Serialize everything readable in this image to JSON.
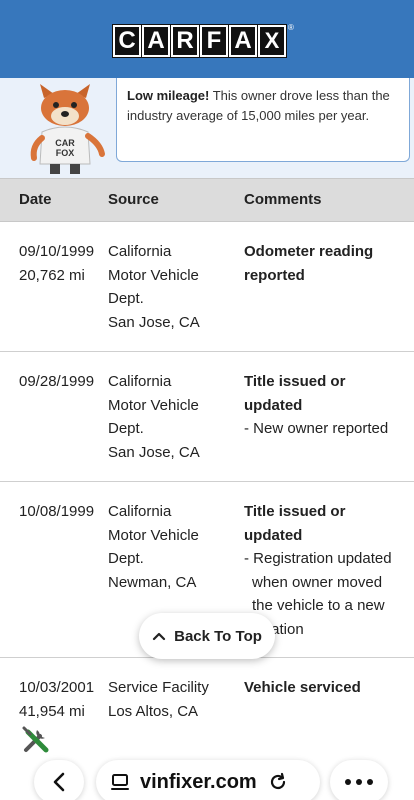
{
  "header": {
    "logo_letters": [
      "C",
      "A",
      "R",
      "F",
      "A",
      "X"
    ],
    "logo_reg": "®"
  },
  "banner": {
    "bold": "Low mileage!",
    "text": " This owner drove less than the industry average of 15,000 miles per year.",
    "fox_shirt": "CAR FOX"
  },
  "table": {
    "headers": {
      "date": "Date",
      "source": "Source",
      "comments": "Comments"
    },
    "rows": [
      {
        "date": [
          "09/10/1999",
          "20,762 mi"
        ],
        "source": [
          "California",
          "Motor Vehicle",
          "Dept.",
          "San Jose, CA"
        ],
        "title": "Odometer reading reported",
        "note": ""
      },
      {
        "date": [
          "09/28/1999"
        ],
        "source": [
          "California",
          "Motor Vehicle",
          "Dept.",
          "San Jose, CA"
        ],
        "title": "Title issued or updated",
        "note": "- New owner reported"
      },
      {
        "date": [
          "10/08/1999"
        ],
        "source": [
          "California",
          "Motor Vehicle",
          "Dept.",
          "Newman, CA"
        ],
        "title": "Title issued or updated",
        "note": "- Registration updated when owner moved the vehicle to a new location"
      },
      {
        "date": [
          "10/03/2001",
          "41,954 mi"
        ],
        "source": [
          "Service Facility",
          "Los Altos, CA"
        ],
        "title": "Vehicle serviced",
        "note": ""
      }
    ]
  },
  "back_to_top": {
    "label": "Back To Top",
    "icon": "chevron-up-icon"
  },
  "browser": {
    "url": "vinfixer.com",
    "icons": [
      "back-arrow-icon",
      "page-icon",
      "reload-icon",
      "more-icon",
      "tools-icon"
    ]
  },
  "colors": {
    "header_bg": "#3777bc",
    "banner_bg": "#eaf1fa",
    "table_header_bg": "#dcdcdc",
    "callout_border": "#7fa8d8"
  }
}
